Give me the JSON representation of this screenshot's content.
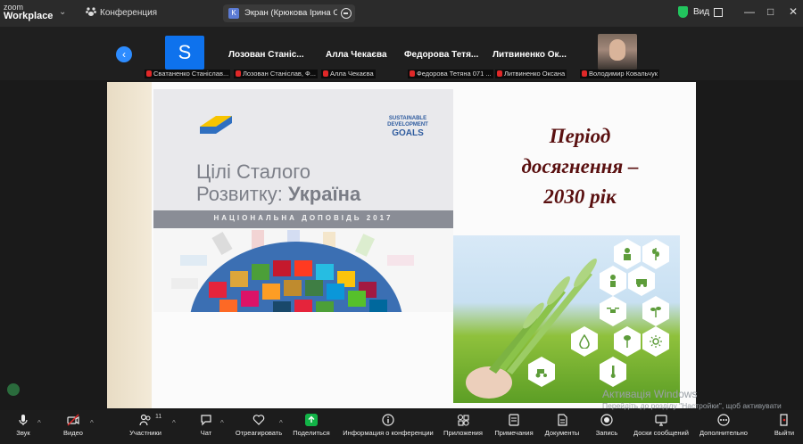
{
  "app": {
    "brand_small": "zoom",
    "brand_big": "Workplace"
  },
  "topbar": {
    "conference_label": "Конференция",
    "tab_title": "Экран (Крюкова Ірина Олексан",
    "view_label": "Вид"
  },
  "participants": {
    "tiles": [
      {
        "initial": "S",
        "label": "Сватаненко Станіслав..."
      },
      {
        "name": "Лозован Станіс...",
        "label": "Лозован Станіслав, Ф..."
      },
      {
        "name": "Алла Чекаєва",
        "label": "Алла Чекаєва"
      },
      {
        "name": "Федорова Тетя...",
        "label": "Федорова Тетяна 071 ..."
      },
      {
        "name": "Литвиненко Ок...",
        "label": "Литвиненко Оксана"
      },
      {
        "label": "Володимир Ковальчук"
      }
    ]
  },
  "slide": {
    "cover_line1": "Цілі Сталого",
    "cover_line2_prefix": "Розвитку: ",
    "cover_line2_bold": "Україна",
    "cover_band": "НАЦІОНАЛЬНА ДОПОВІДЬ 2017",
    "sdg_line1": "SUSTAINABLE",
    "sdg_line2": "DEVELOPMENT",
    "sdg_line3": "GOALS",
    "heading_line1": "Період",
    "heading_line2": "досягнення –",
    "heading_line3": "2030 рік"
  },
  "watermark": {
    "title": "Активація Windows",
    "text": "Перейдіть до розділу \"Настройки\", щоб активувати Windows."
  },
  "toolbar": {
    "sound": "Звук",
    "video": "Видео",
    "participants": "Участники",
    "participants_count": "11",
    "chat": "Чат",
    "react": "Отреагировать",
    "share": "Поделиться",
    "info": "Информация о конференции",
    "apps": "Приложения",
    "notes": "Примечания",
    "docs": "Документы",
    "record": "Запись",
    "whiteboards": "Доски сообщений",
    "more": "Дополнительно",
    "leave": "Выйти"
  },
  "colors": {
    "accent": "#2d8cff",
    "share": "#12b347",
    "heading": "#5a1010",
    "muted": "#e02828"
  }
}
